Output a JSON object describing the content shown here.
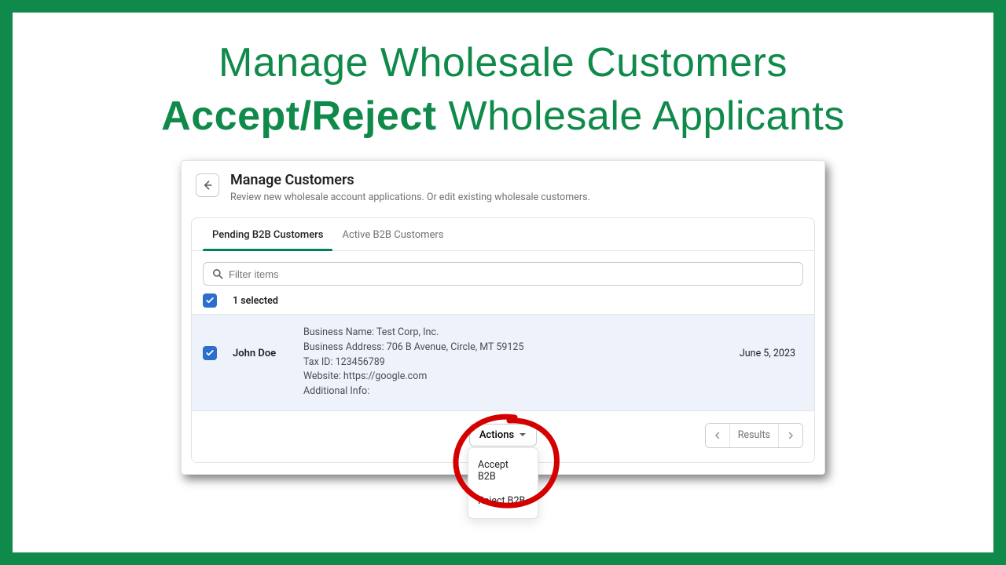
{
  "banner": {
    "line1": "Manage Wholesale Customers",
    "line2_bold": "Accept/Reject",
    "line2_rest": " Wholesale Applicants"
  },
  "header": {
    "title": "Manage Customers",
    "subtitle": "Review new wholesale account applications. Or edit existing wholesale customers."
  },
  "tabs": {
    "pending": "Pending B2B Customers",
    "active": "Active B2B Customers"
  },
  "filter": {
    "placeholder": "Filter items"
  },
  "selection": {
    "count_label": "1 selected"
  },
  "row": {
    "name": "John Doe",
    "business_name": "Business Name: Test Corp, Inc.",
    "business_address": "Business Address: 706 B Avenue, Circle, MT 59125",
    "tax_id": "Tax ID: 123456789",
    "website": "Website: https://google.com",
    "additional_info": "Additional Info:",
    "date": "June 5, 2023"
  },
  "actions": {
    "button_label": "Actions",
    "accept": "Accept B2B",
    "reject": "Reject B2B"
  },
  "pager": {
    "label": "Results"
  },
  "colors": {
    "accent": "#0f8a4a",
    "annotation": "#d40000"
  }
}
